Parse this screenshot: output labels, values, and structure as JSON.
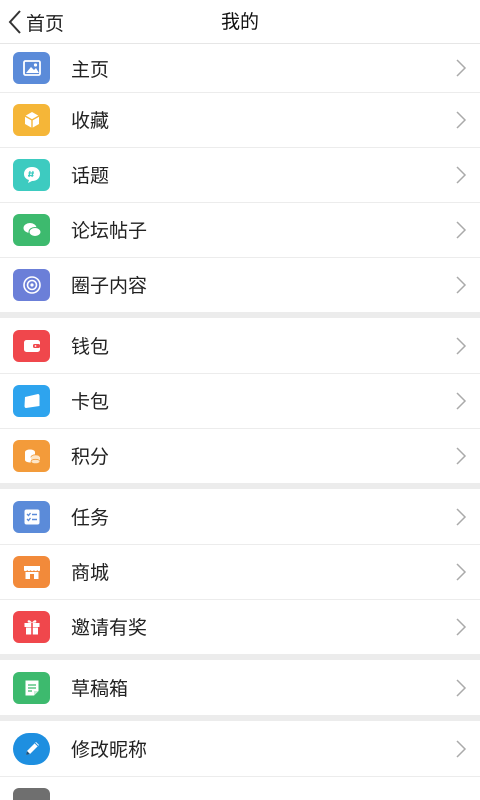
{
  "header": {
    "back_label": "首页",
    "title": "我的"
  },
  "colors": {
    "home": "#5b8bd9",
    "favorite": "#f5b638",
    "topic": "#3dcbc0",
    "forum": "#3dba6e",
    "circle": "#6b7fd8",
    "wallet": "#f0474c",
    "cardbag": "#2ea4ee",
    "points": "#f39b3a",
    "task": "#5b8bd9",
    "mall": "#f28a3a",
    "invite": "#f0474c",
    "drafts": "#3dba6e",
    "nickname": "#1e8fe0",
    "partial": "#6f6f6f"
  },
  "groups": [
    {
      "items": [
        {
          "label": "主页",
          "icon": "image-icon"
        },
        {
          "label": "收藏",
          "icon": "box-icon"
        },
        {
          "label": "话题",
          "icon": "hashtag-bubble-icon"
        },
        {
          "label": "论坛帖子",
          "icon": "chat-bubbles-icon"
        },
        {
          "label": "圈子内容",
          "icon": "circle-swirl-icon"
        }
      ]
    },
    {
      "items": [
        {
          "label": "钱包",
          "icon": "wallet-icon"
        },
        {
          "label": "卡包",
          "icon": "card-icon"
        },
        {
          "label": "积分",
          "icon": "coins-icon"
        }
      ]
    },
    {
      "items": [
        {
          "label": "任务",
          "icon": "task-list-icon"
        },
        {
          "label": "商城",
          "icon": "store-icon"
        },
        {
          "label": "邀请有奖",
          "icon": "gift-icon"
        }
      ]
    },
    {
      "items": [
        {
          "label": "草稿箱",
          "icon": "draft-note-icon"
        }
      ]
    },
    {
      "items": [
        {
          "label": "修改昵称",
          "icon": "pencil-icon"
        }
      ]
    }
  ]
}
